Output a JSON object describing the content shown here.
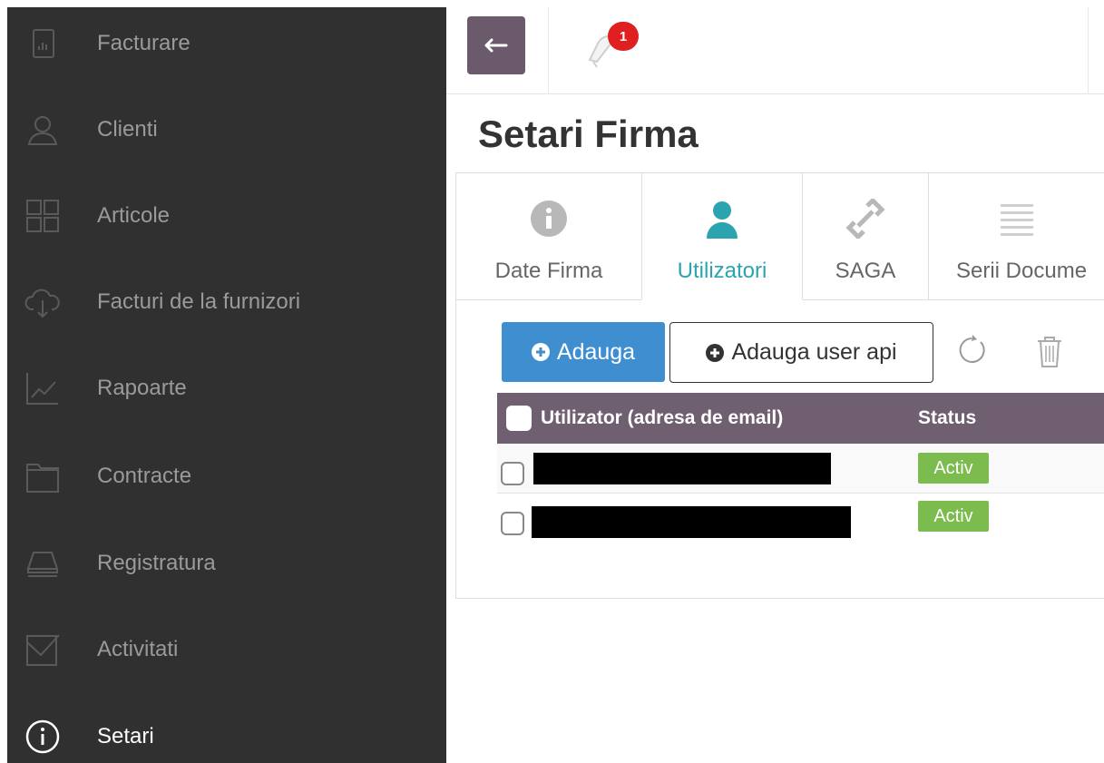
{
  "sidebar": {
    "items": [
      {
        "label": "Facturare",
        "icon": "invoice-icon"
      },
      {
        "label": "Clienti",
        "icon": "user-icon"
      },
      {
        "label": "Articole",
        "icon": "grid-icon"
      },
      {
        "label": "Facturi de la furnizori",
        "icon": "cloud-download-icon"
      },
      {
        "label": "Rapoarte",
        "icon": "chart-icon"
      },
      {
        "label": "Contracte",
        "icon": "folder-icon"
      },
      {
        "label": "Registratura",
        "icon": "inbox-icon"
      },
      {
        "label": "Activitati",
        "icon": "checkbox-icon"
      },
      {
        "label": "Setari",
        "icon": "info-icon",
        "active": true
      }
    ]
  },
  "topbar": {
    "back_icon": "arrow-left-icon",
    "notifications_count": "1"
  },
  "page": {
    "title": "Setari Firma"
  },
  "tabs": [
    {
      "label": "Date Firma",
      "icon": "info-icon"
    },
    {
      "label": "Utilizatori",
      "icon": "user-icon",
      "active": true
    },
    {
      "label": "SAGA",
      "icon": "link-icon"
    },
    {
      "label": "Serii Docume",
      "icon": "list-icon"
    }
  ],
  "toolbar": {
    "add_label": "Adauga",
    "add_api_label": "Adauga user api"
  },
  "table": {
    "headers": [
      "Utilizator (adresa de email)",
      "Status"
    ],
    "rows": [
      {
        "email": "[redacted]",
        "status": "Activ"
      },
      {
        "email": "[redacted]",
        "status": "Activ"
      }
    ]
  },
  "colors": {
    "sidebar_bg": "#303030",
    "accent_teal": "#2ba4b0",
    "primary_blue": "#3f8fd0",
    "table_header": "#6f5f71",
    "status_green": "#7cbc4e",
    "back_button": "#6b5a6b",
    "badge_red": "#e02020"
  }
}
